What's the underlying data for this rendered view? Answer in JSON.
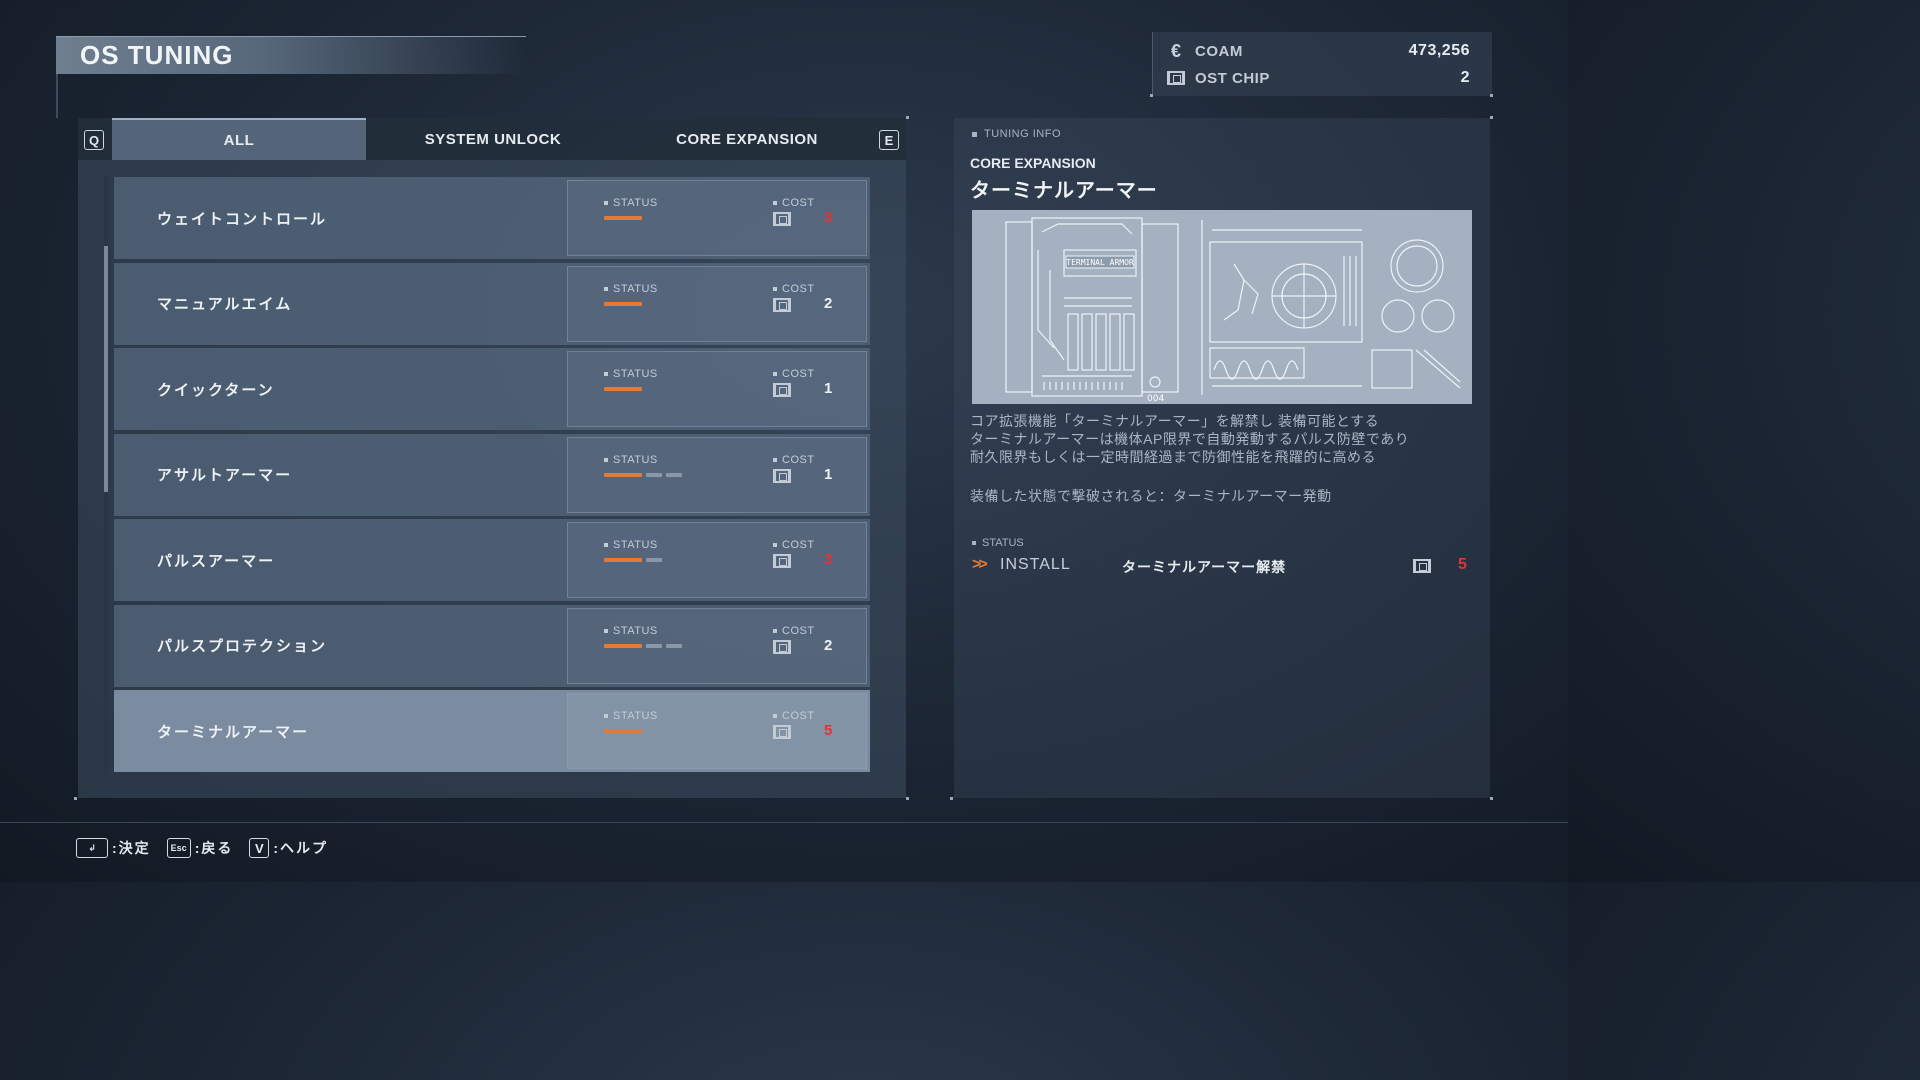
{
  "header": {
    "title": "OS TUNING"
  },
  "currency": [
    {
      "icon": "coam-icon",
      "label": "COAM",
      "value": "473,256"
    },
    {
      "icon": "chip-icon",
      "label": "OST CHIP",
      "value": "2"
    }
  ],
  "tabs": {
    "prev_key": "Q",
    "next_key": "E",
    "items": [
      {
        "label": "ALL",
        "active": true
      },
      {
        "label": "SYSTEM UNLOCK",
        "active": false
      },
      {
        "label": "CORE EXPANSION",
        "active": false
      }
    ]
  },
  "list": {
    "status_label": "STATUS",
    "cost_label": "COST",
    "items": [
      {
        "name": "ウェイトコントロール",
        "status_level": 1,
        "status_max": 1,
        "cost": "3",
        "cost_red": true
      },
      {
        "name": "マニュアルエイム",
        "status_level": 1,
        "status_max": 1,
        "cost": "2",
        "cost_red": false
      },
      {
        "name": "クイックターン",
        "status_level": 1,
        "status_max": 1,
        "cost": "1",
        "cost_red": false
      },
      {
        "name": "アサルトアーマー",
        "status_level": 1,
        "status_max": 3,
        "cost": "1",
        "cost_red": false
      },
      {
        "name": "パルスアーマー",
        "status_level": 1,
        "status_max": 2,
        "cost": "3",
        "cost_red": true
      },
      {
        "name": "パルスプロテクション",
        "status_level": 1,
        "status_max": 3,
        "cost": "2",
        "cost_red": false
      },
      {
        "name": "ターミナルアーマー",
        "status_level": 1,
        "status_max": 1,
        "cost": "5",
        "cost_red": true,
        "selected": true
      }
    ]
  },
  "info": {
    "heading": "TUNING INFO",
    "category": "CORE EXPANSION",
    "name": "ターミナルアーマー",
    "blueprint_label": "TERMINAL ARMOR",
    "blueprint_number": "004",
    "description": [
      "コア拡張機能「ターミナルアーマー」を解禁し 装備可能とする",
      "ターミナルアーマーは機体AP限界で自動発動するパルス防壁であり",
      "耐久限界もしくは一定時間経過まで防御性能を飛躍的に高める"
    ],
    "effect": "装備した状態で撃破されると：ターミナルアーマー発動",
    "status_heading": "STATUS",
    "install_label": "INSTALL",
    "install_value": "ターミナルアーマー解禁",
    "install_cost": "5"
  },
  "footer": {
    "confirm": ":決定",
    "back_key": "Esc",
    "back": ":戻る",
    "help_key": "V",
    "help": ":ヘルプ"
  },
  "colors": {
    "accent_orange": "#e47a36",
    "cost_red": "#e23434",
    "panel": "#546579"
  }
}
